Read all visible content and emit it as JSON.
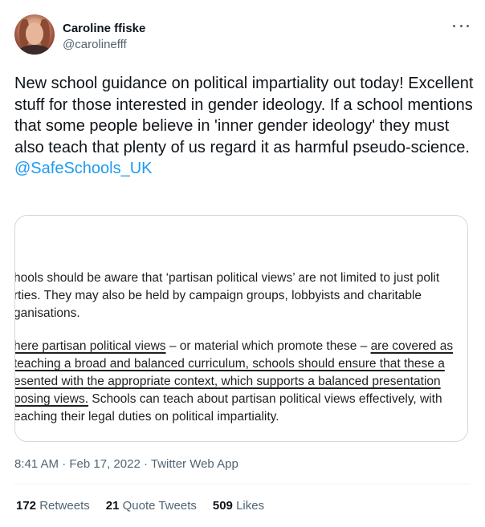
{
  "author": {
    "display_name": "Caroline ffiske",
    "handle": "@carolinefff"
  },
  "more_icon": "more-horizontal-icon",
  "tweet": {
    "text": "New school guidance on political impartiality out today! Excellent stuff for those interested in gender ideology. If a school mentions that some people believe in 'inner gender ideology' they must also teach that plenty of us regard it as harmful pseudo-science.",
    "mention": "@SafeSchools_UK"
  },
  "media": {
    "lines": [
      {
        "id": "l1",
        "text": "hools should be aware that ‘partisan political views’ are not limited to just polit"
      },
      {
        "id": "l2",
        "text": "rties. They may also be held by campaign groups, lobbyists and charitable"
      },
      {
        "id": "l3",
        "text": "ganisations."
      },
      {
        "id": "l4a",
        "text": "here partisan political views",
        "u": true
      },
      {
        "id": "l4b",
        "text": " – or material which promote these – "
      },
      {
        "id": "l4c",
        "text": "are covered as",
        "u": true
      },
      {
        "id": "l5",
        "text": "teaching a broad and balanced curriculum, schools should ensure that these a",
        "u": true
      },
      {
        "id": "l6",
        "text": "esented with the appropriate context, which supports a balanced presentation",
        "u": true
      },
      {
        "id": "l7a",
        "text": "posing views.",
        "u": true
      },
      {
        "id": "l7b",
        "text": " Schools can teach about partisan political views effectively, with"
      },
      {
        "id": "l8",
        "text": "eaching their legal duties on political impartiality."
      }
    ]
  },
  "meta": {
    "time": "8:41 AM",
    "date": "Feb 17, 2022",
    "source": "Twitter Web App",
    "separator": " · "
  },
  "stats": {
    "retweets_count": "172",
    "retweets_label": "Retweets",
    "quotes_count": "21",
    "quotes_label": "Quote Tweets",
    "likes_count": "509",
    "likes_label": "Likes"
  }
}
